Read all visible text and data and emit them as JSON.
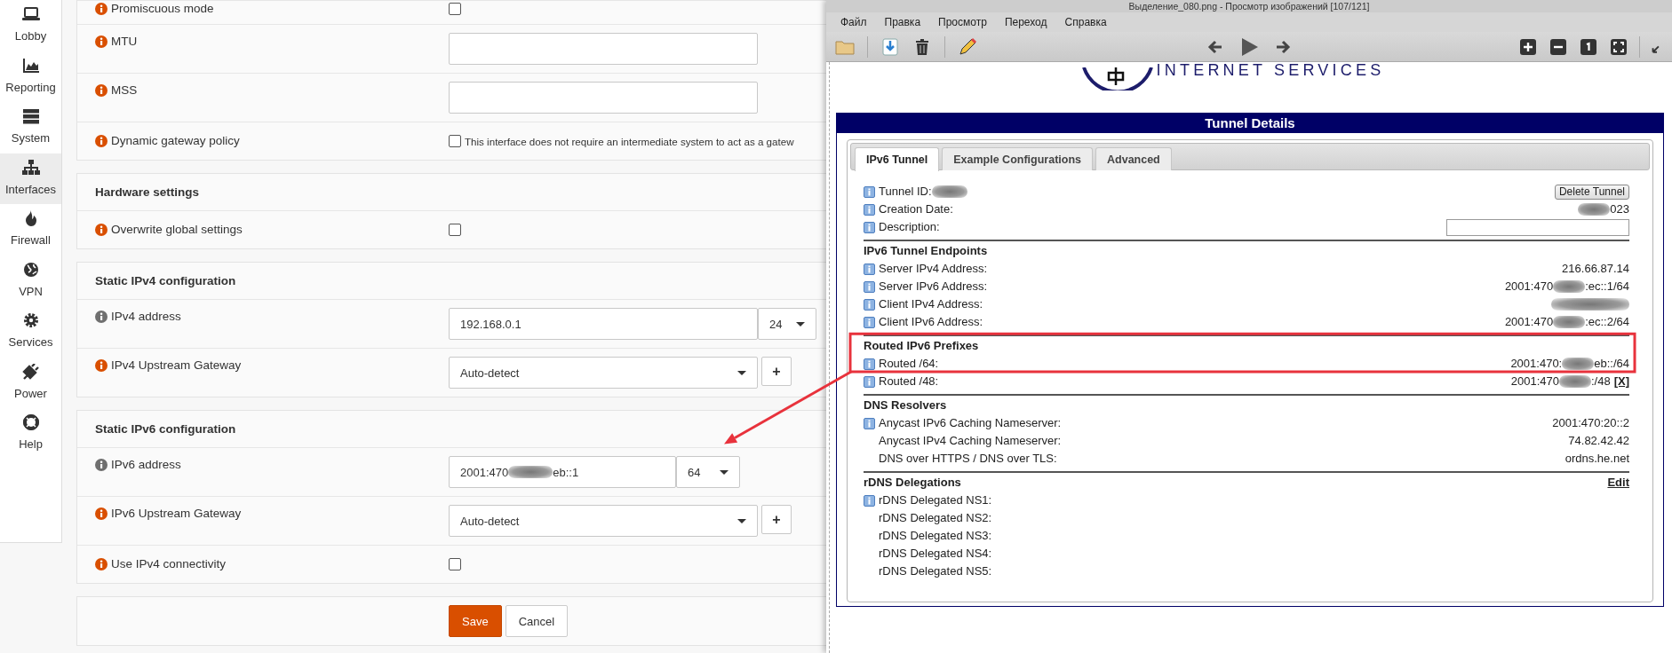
{
  "sidebar": {
    "items": [
      {
        "label": "Lobby",
        "kind": "laptop",
        "selected": false
      },
      {
        "label": "Reporting",
        "kind": "chart",
        "selected": false
      },
      {
        "label": "System",
        "kind": "server",
        "selected": false
      },
      {
        "label": "Interfaces",
        "kind": "sitemap",
        "selected": true
      },
      {
        "label": "Firewall",
        "kind": "fire",
        "selected": false
      },
      {
        "label": "VPN",
        "kind": "globe",
        "selected": false
      },
      {
        "label": "Services",
        "kind": "gear",
        "selected": false
      },
      {
        "label": "Power",
        "kind": "plug",
        "selected": false
      },
      {
        "label": "Help",
        "kind": "lifering",
        "selected": false
      }
    ]
  },
  "form": {
    "sections": [
      {
        "rows": [
          {
            "label": "Promiscuous mode",
            "color": "#d94f00",
            "kind": "checkbox",
            "checked": false
          },
          {
            "label": "MTU",
            "color": "#d94f00",
            "kind": "text"
          },
          {
            "label": "MSS",
            "color": "#d94f00",
            "kind": "text"
          },
          {
            "label": "Dynamic gateway policy",
            "color": "#d94f00",
            "kind": "checkbox",
            "checked": false,
            "text": "This interface does not require an intermediate system to act as a gatew"
          }
        ]
      },
      {
        "title": "Hardware settings",
        "rows": [
          {
            "label": "Overwrite global settings",
            "color": "#d94f00",
            "kind": "checkbox",
            "checked": false
          }
        ]
      },
      {
        "title": "Static IPv4 configuration",
        "rows": [
          {
            "label": "IPv4 address",
            "color": "#6f6f6f",
            "kind": "address",
            "value": "192.168.0.1",
            "prefix": "24"
          },
          {
            "label": "IPv4 Upstream Gateway",
            "color": "#d94f00",
            "kind": "gateway",
            "value": "Auto-detect",
            "button": "+"
          }
        ]
      },
      {
        "title": "Static IPv6 configuration",
        "rows": [
          {
            "label": "IPv6 address",
            "color": "#6f6f6f",
            "kind": "address",
            "value": "2001:470",
            "redacted": true,
            "value_end": "eb::1",
            "prefix": "64",
            "annotated": true
          },
          {
            "label": "IPv6 Upstream Gateway",
            "color": "#d94f00",
            "kind": "gateway",
            "value": "Auto-detect",
            "button": "+"
          },
          {
            "label": "Use IPv4 connectivity",
            "color": "#d94f00",
            "kind": "checkbox",
            "checked": false
          }
        ]
      }
    ],
    "actions": [
      {
        "label": "Save",
        "kind": "primary"
      },
      {
        "label": "Cancel",
        "kind": "secondary"
      }
    ]
  },
  "viewer": {
    "title": "Выделение_080.png - Просмотр изображений [107/121]",
    "menu": [
      "Файл",
      "Правка",
      "Просмотр",
      "Переход",
      "Справка"
    ],
    "logo_text": "INTERNET SERVICES",
    "panel": {
      "title": "Tunnel Details",
      "tabs": [
        {
          "label": "IPv6 Tunnel",
          "selected": true
        },
        {
          "label": "Example Configurations",
          "selected": false
        },
        {
          "label": "Advanced",
          "selected": false
        }
      ],
      "sections": [
        {
          "rows": [
            {
              "label": "Tunnel ID:",
              "info": true,
              "redacted": true,
              "inline": true,
              "button": "Delete Tunnel"
            },
            {
              "label": "Creation Date:",
              "info": true,
              "redacted": true,
              "after": "023"
            },
            {
              "label": "Description:",
              "info": true,
              "field": true
            }
          ]
        },
        {
          "title": "IPv6 Tunnel Endpoints",
          "rows": [
            {
              "label": "Server IPv4 Address:",
              "info": true,
              "before": "216.66.87.14"
            },
            {
              "label": "Server IPv6 Address:",
              "info": true,
              "before": "2001:470",
              "redacted": true,
              "after": ":ec::1/64"
            },
            {
              "label": "Client IPv4 Address:",
              "info": true,
              "redacted": true
            },
            {
              "label": "Client IPv6 Address:",
              "info": true,
              "before": "2001:470",
              "redacted": true,
              "after": ":ec::2/64"
            }
          ]
        },
        {
          "title": "Routed IPv6 Prefixes",
          "highlighted": true,
          "rows": [
            {
              "label": "Routed /64:",
              "info": true,
              "before": "2001:470:",
              "redacted": true,
              "after": "eb::/64",
              "highlighted": true
            },
            {
              "label": "Routed /48:",
              "info": true,
              "before": "2001:470",
              "redacted": true,
              "after": ":/48",
              "link": "[X]",
              "highlighted": false
            }
          ]
        },
        {
          "title": "DNS Resolvers",
          "rows": [
            {
              "label": "Anycast IPv6 Caching Nameserver:",
              "info": true,
              "before": "2001:470:20::2"
            },
            {
              "label": "Anycast IPv4 Caching Nameserver:",
              "info": false,
              "before": "74.82.42.42"
            },
            {
              "label": "DNS over HTTPS / DNS over TLS:",
              "info": false,
              "before": "ordns.he.net"
            }
          ]
        },
        {
          "title": "rDNS Delegations",
          "action": "Edit",
          "rows": [
            {
              "label": "rDNS Delegated NS1:",
              "info": true
            },
            {
              "label": "rDNS Delegated NS2:",
              "info": false
            },
            {
              "label": "rDNS Delegated NS3:",
              "info": false
            },
            {
              "label": "rDNS Delegated NS4:",
              "info": false
            },
            {
              "label": "rDNS Delegated NS5:",
              "info": false
            }
          ]
        }
      ]
    }
  }
}
